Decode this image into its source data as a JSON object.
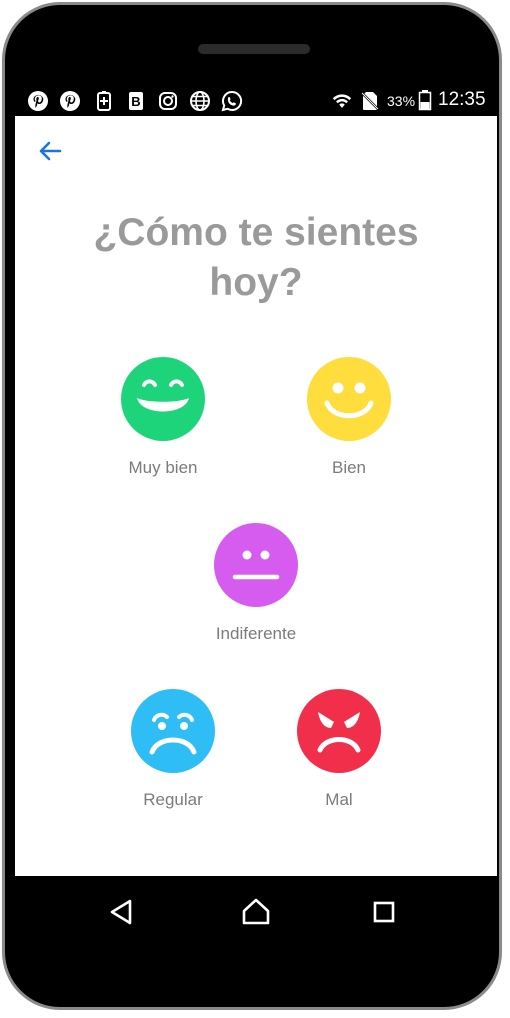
{
  "status_bar": {
    "left_icons": [
      "pinterest-icon",
      "pinterest-icon",
      "battery-saver-icon",
      "b-app-icon",
      "instagram-icon",
      "globe-icon",
      "whatsapp-icon"
    ],
    "battery_percent": "33%",
    "time": "12:35"
  },
  "header": {
    "back_icon": "arrow-left-icon"
  },
  "screen": {
    "title": "¿Cómo te sientes hoy?"
  },
  "moods": [
    {
      "label": "Muy bien",
      "color": "#1ed47a",
      "icon": "big-smile-face-icon"
    },
    {
      "label": "Bien",
      "color": "#ffdd3c",
      "icon": "smile-face-icon"
    },
    {
      "label": "Indiferente",
      "color": "#d65cf0",
      "icon": "neutral-face-icon"
    },
    {
      "label": "Regular",
      "color": "#2ebdf5",
      "icon": "sad-face-icon"
    },
    {
      "label": "Mal",
      "color": "#f22f4a",
      "icon": "angry-face-icon"
    }
  ],
  "nav": {
    "icons": [
      "back-triangle-icon",
      "home-icon",
      "recents-square-icon"
    ]
  },
  "colors": {
    "accent": "#1a73e8",
    "title": "#9a9a9a",
    "label": "#7b7b7b"
  }
}
